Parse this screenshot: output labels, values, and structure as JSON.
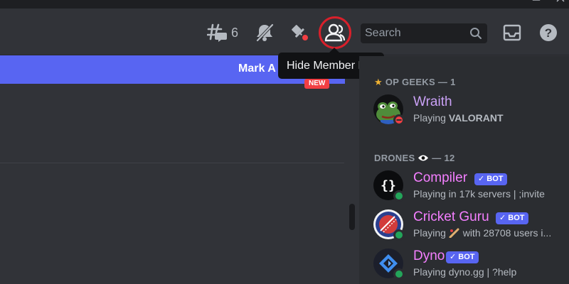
{
  "colors": {
    "accent": "#5865f2",
    "online": "#23a55a",
    "dnd": "#f23f43",
    "highlight_ring": "#d8202b",
    "name_purple": "#c9a0f5",
    "name_pink": "#f47fff"
  },
  "window_controls": [
    "minimize-icon",
    "maximize-icon",
    "close-icon"
  ],
  "header": {
    "threads_icon": "threads-icon",
    "threads_count": "6",
    "mute_icon": "bell-slash-icon",
    "pins_icon": "pin-icon",
    "member_list_icon": "members-icon",
    "search": {
      "placeholder": "Search",
      "icon": "search-icon"
    },
    "inbox_icon": "inbox-icon",
    "help_icon": "help-icon"
  },
  "tooltip": {
    "text": "Hide Member List"
  },
  "main": {
    "banner_text": "Mark A",
    "new_badge": "NEW"
  },
  "members": {
    "groups": [
      {
        "header": "OP GEEKS — 1",
        "header_icon": "star-icon",
        "items": [
          {
            "name": "Wraith",
            "activity_prefix": "Playing ",
            "activity_bold": "VALORANT",
            "status": "dnd",
            "bot": false
          }
        ]
      },
      {
        "header_prefix": "DRONES",
        "header_suffix": "— 12",
        "header_icon": "eye-icon",
        "items": [
          {
            "name": "Compiler",
            "bot": true,
            "bot_label": "BOT",
            "activity": "Playing in 17k servers | ;invite",
            "status": "online"
          },
          {
            "name": "Cricket Guru",
            "bot": true,
            "bot_label": "BOT",
            "activity_prefix": "Playing ",
            "activity_suffix": " with 28708 users i...",
            "activity_icon": "cricket-bat-icon",
            "status": "online"
          },
          {
            "name": "Dyno",
            "bot": true,
            "bot_label": "BOT",
            "activity": "Playing dyno.gg | ?help",
            "status": "online"
          }
        ]
      }
    ]
  }
}
